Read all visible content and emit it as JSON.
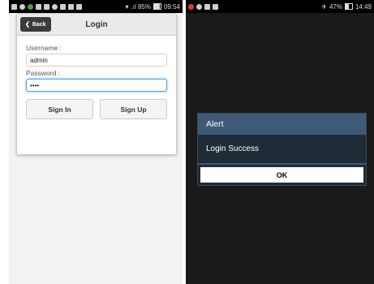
{
  "left_phone": {
    "status_bar": {
      "signal_text": ".ıl 85%",
      "time": "09:54",
      "icons": [
        "back-arrow-icon",
        "bullet-icon",
        "notification-icon",
        "app-icon",
        "app-icon",
        "usb-icon",
        "app-icon",
        "message-icon",
        "key-icon",
        "wifi-icon"
      ]
    },
    "login": {
      "back_label": "Back",
      "title": "Login",
      "username_label": "Username :",
      "username_value": "admin",
      "password_label": "Password :",
      "password_value": "••••",
      "sign_in_label": "Sign In",
      "sign_up_label": "Sign Up"
    }
  },
  "right_phone": {
    "status_bar": {
      "battery_text": "47%",
      "battery_level": 0.47,
      "time": "14:49",
      "icons": [
        "notification-icon",
        "sound-icon",
        "message-icon",
        "message-icon",
        "airplane-icon"
      ]
    },
    "alert": {
      "title": "Alert",
      "message": "Login Success",
      "ok_label": "OK"
    }
  },
  "colors": {
    "alert_title_bg": "#3e5a78",
    "alert_body_bg": "#1f2b36",
    "back_button_bg": "#3b3b3b",
    "focus_border": "#5aa0e0"
  }
}
